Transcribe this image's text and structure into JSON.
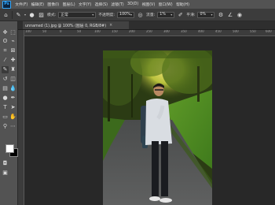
{
  "menubar": {
    "logo": "Ps",
    "items": [
      "文件(F)",
      "编辑(E)",
      "图像(I)",
      "图层(L)",
      "文字(Y)",
      "选择(S)",
      "滤镜(T)",
      "3D(D)",
      "视图(V)",
      "窗口(W)",
      "帮助(H)"
    ]
  },
  "options": {
    "mode_label": "模式:",
    "mode_value": "正常",
    "opacity_label": "不透明度:",
    "opacity_value": "100%",
    "flow_label": "流量:",
    "flow_value": "1%",
    "smooth_label": "平滑:",
    "smooth_value": "0%"
  },
  "document": {
    "tab_title": "unnamed (1).jpg @ 100% (图层 0, RGB/8#)",
    "close_glyph": "×"
  },
  "ruler": {
    "top_ticks": [
      "100",
      "50",
      "0",
      "50",
      "100",
      "150",
      "200",
      "250",
      "300",
      "350",
      "400",
      "450",
      "500",
      "550",
      "600"
    ]
  },
  "colors": {
    "foreground": "#ffffff",
    "background": "#000000",
    "accent": "#31a8ff"
  }
}
